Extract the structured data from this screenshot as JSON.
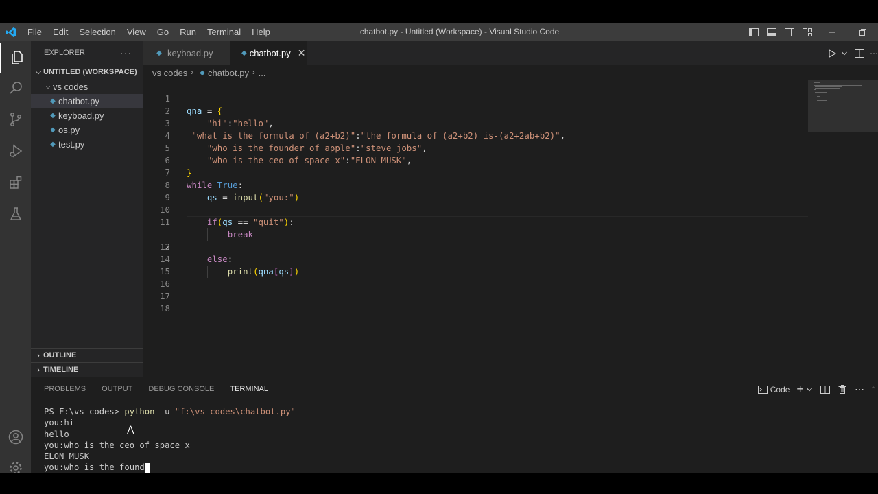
{
  "window_title": "chatbot.py - Untitled (Workspace) - Visual Studio Code",
  "menu": [
    "File",
    "Edit",
    "Selection",
    "View",
    "Go",
    "Run",
    "Terminal",
    "Help"
  ],
  "sidebar": {
    "header": "EXPLORER",
    "more": "···",
    "workspace": "UNTITLED (WORKSPACE)",
    "folder": "vs codes",
    "files": [
      "chatbot.py",
      "keyboad.py",
      "os.py",
      "test.py"
    ],
    "selected_file": "chatbot.py",
    "outline": "OUTLINE",
    "timeline": "TIMELINE"
  },
  "tabs": [
    {
      "label": "keyboad.py",
      "active": false
    },
    {
      "label": "chatbot.py",
      "active": true
    }
  ],
  "breadcrumbs": [
    "vs codes",
    "chatbot.py",
    "..."
  ],
  "editor": {
    "current_line": 12,
    "line_numbers": [
      "1",
      "2",
      "3",
      "4",
      "5",
      "6",
      "7",
      "8",
      "9",
      "10",
      "11",
      "12",
      "13",
      "14",
      "15",
      "16",
      "17",
      "18"
    ],
    "lines": [
      "qna = {",
      "    \"hi\":\"hello\",",
      " \"what is the formula of (a2+b2)\":\"the formula of (a2+b2) is-(a2+2ab+b2)\",",
      "    \"who is the founder of apple\":\"steve jobs\",",
      "    \"who is the ceo of space x\":\"ELON MUSK\",",
      "}",
      "while True:",
      "    qs = input(\"you:\")",
      "",
      "    if(qs == \"quit\"):",
      "        break",
      "",
      "    else:",
      "        print(qna[qs])",
      "",
      "",
      "",
      ""
    ]
  },
  "panel": {
    "tabs": [
      "PROBLEMS",
      "OUTPUT",
      "DEBUG CONSOLE",
      "TERMINAL"
    ],
    "active_tab": "TERMINAL",
    "shell_label": "Code",
    "terminal": {
      "prompt": "PS F:\\vs codes> ",
      "command": "python",
      "args": " -u ",
      "path": "\"f:\\vs codes\\chatbot.py\"",
      "output": [
        "you:hi",
        "hello",
        "you:who is the ceo of space x",
        "ELON MUSK",
        "you:who is the found"
      ]
    }
  },
  "colors": {
    "activity_bar": "#333333",
    "sidebar": "#252526",
    "editor_bg": "#1e1e1e",
    "titlebar": "#3c3c3c",
    "accent": "#007acc"
  },
  "icons": {
    "activity": [
      "files-icon",
      "search-icon",
      "source-control-icon",
      "run-debug-icon",
      "extensions-icon",
      "testing-icon",
      "account-icon",
      "settings-gear-icon"
    ]
  }
}
